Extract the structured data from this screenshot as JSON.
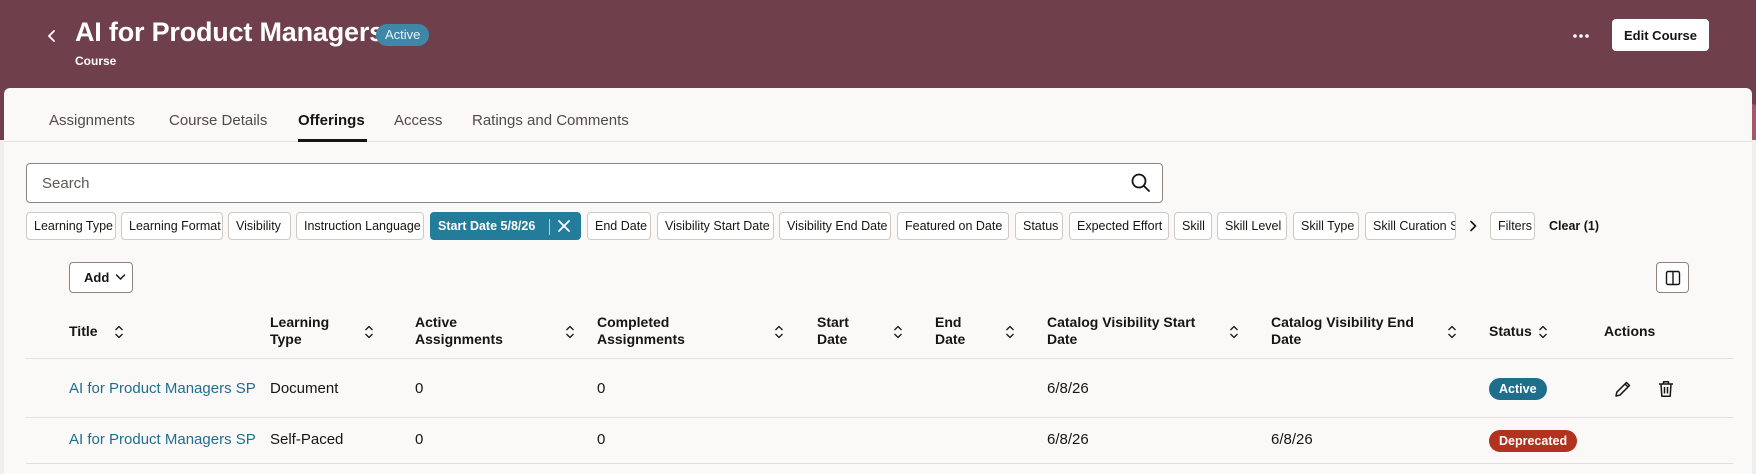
{
  "header": {
    "title": "AI for Product Managers",
    "status_badge": "Active",
    "subtitle": "Course",
    "edit_button": "Edit Course",
    "more_icon": "more-horizontal-icon",
    "back_icon": "chevron-left-icon",
    "background_color": "#6f3f4b"
  },
  "tabs": [
    {
      "label": "Assignments",
      "active": false
    },
    {
      "label": "Course Details",
      "active": false
    },
    {
      "label": "Offerings",
      "active": true
    },
    {
      "label": "Access",
      "active": false
    },
    {
      "label": "Ratings and Comments",
      "active": false
    }
  ],
  "search": {
    "placeholder": "Search",
    "icon": "search-icon"
  },
  "filters": {
    "chips": [
      "Learning Type",
      "Learning Format",
      "Visibility",
      "Instruction Language",
      "Start Date 5/8/26",
      "End Date",
      "Visibility Start Date",
      "Visibility End Date",
      "Featured on Date",
      "Status",
      "Expected Effort",
      "Skill",
      "Skill Level",
      "Skill Type",
      "Skill Curation St",
      "Filters"
    ],
    "selected_chip": "Start Date 5/8/26",
    "clear_label": "Clear (1)"
  },
  "toolbar": {
    "add_label": "Add"
  },
  "table": {
    "columns": [
      "Title",
      "Learning Type",
      "Active Assignments",
      "Completed Assignments",
      "Start Date",
      "End Date",
      "Catalog Visibility Start Date",
      "Catalog Visibility End Date",
      "Status",
      "Actions"
    ],
    "rows": [
      {
        "title": "AI for Product Managers SP",
        "learning_type": "Document",
        "active_assignments": "0",
        "completed_assignments": "0",
        "start_date": "",
        "end_date": "",
        "catalog_visibility_start": "6/8/26",
        "catalog_visibility_end": "",
        "status": "Active",
        "status_color": "#1f6e8c",
        "actions": [
          "edit-icon",
          "trash-icon"
        ]
      },
      {
        "title": "AI for Product Managers SP",
        "learning_type": "Self-Paced",
        "active_assignments": "0",
        "completed_assignments": "0",
        "start_date": "",
        "end_date": "",
        "catalog_visibility_start": "6/8/26",
        "catalog_visibility_end": "6/8/26",
        "status": "Deprecated",
        "status_color": "#b1321f",
        "actions": []
      }
    ]
  },
  "colors": {
    "accent": "#227c9a",
    "link": "#1e6f8f"
  }
}
